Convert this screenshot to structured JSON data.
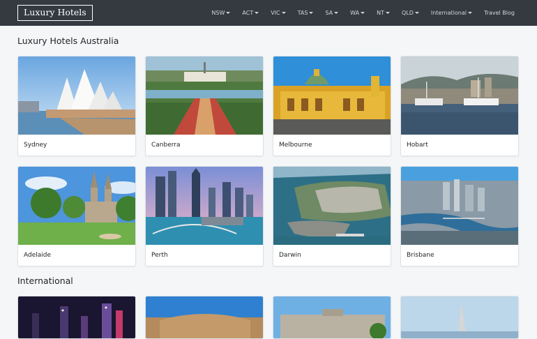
{
  "navbar": {
    "brand": "Luxury Hotels",
    "items": [
      {
        "label": "NSW",
        "dropdown": true
      },
      {
        "label": "ACT",
        "dropdown": true
      },
      {
        "label": "VIC",
        "dropdown": true
      },
      {
        "label": "TAS",
        "dropdown": true
      },
      {
        "label": "SA",
        "dropdown": true
      },
      {
        "label": "WA",
        "dropdown": true
      },
      {
        "label": "NT",
        "dropdown": true
      },
      {
        "label": "QLD",
        "dropdown": true
      },
      {
        "label": "International",
        "dropdown": true
      },
      {
        "label": "Travel Blog",
        "dropdown": false
      }
    ]
  },
  "sections": {
    "australia": {
      "title": "Luxury Hotels Australia",
      "cards": [
        "Sydney",
        "Canberra",
        "Melbourne",
        "Hobart",
        "Adelaide",
        "Perth",
        "Darwin",
        "Brisbane"
      ]
    },
    "international": {
      "title": "International"
    }
  },
  "colors": {
    "navbar": "#343a40",
    "background": "#f5f6f8",
    "card_border": "#dfe2e6"
  }
}
